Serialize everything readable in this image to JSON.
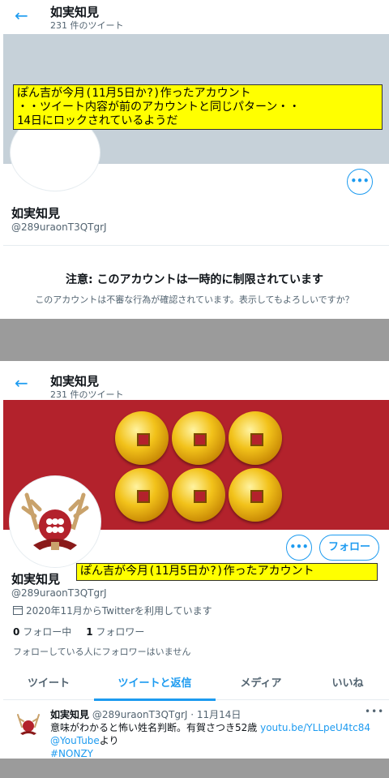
{
  "panel1": {
    "header": {
      "name": "如実知見",
      "tweet_count": "231 件のツイート"
    },
    "overlay_lines": [
      "ぽん吉が今月(11月5日か?)作ったアカウント",
      "・・ツイート内容が前のアカウントと同じパターン・・",
      "14日にロックされているようだ"
    ],
    "profile": {
      "name": "如実知見",
      "handle": "@289uraonT3QTgrJ"
    },
    "more_label": "•••",
    "notice": {
      "title": "注意: このアカウントは一時的に制限されています",
      "body": "このアカウントは不審な行為が確認されています。表示してもよろしいですか？"
    }
  },
  "panel2": {
    "header": {
      "name": "如実知見",
      "tweet_count": "231 件のツイート"
    },
    "more_label": "•••",
    "follow_label": "フォロー",
    "overlay": "ぽん吉が今月(11月5日か?)作ったアカウント",
    "profile": {
      "name": "如実知見",
      "handle": "@289uraonT3QTgrJ",
      "joined": "2020年11月からTwitterを利用しています",
      "following_count": "0",
      "following_label": "フォロー中",
      "followers_count": "1",
      "followers_label": "フォロワー",
      "no_mutual": "フォローしている人にフォロワーはいません"
    },
    "tabs": [
      "ツイート",
      "ツイートと返信",
      "メディア",
      "いいね"
    ],
    "active_tab": 1,
    "tweet": {
      "name": "如実知見",
      "handle": "@289uraonT3QTgrJ",
      "date": "· 11月14日",
      "more": "•••",
      "text": "意味がわかると怖い姓名判断。有賀さつき52歳 ",
      "link": "youtu.be/YLLpeU4tc84",
      "via_link": "@YouTube",
      "via_suffix": "より",
      "hashtag": "#NONZY"
    }
  },
  "colors": {
    "accent": "#1d9bf0",
    "banner_red": "#b3222c",
    "overlay_yellow": "#ffff00",
    "gap_gray": "#9b9b9b"
  }
}
